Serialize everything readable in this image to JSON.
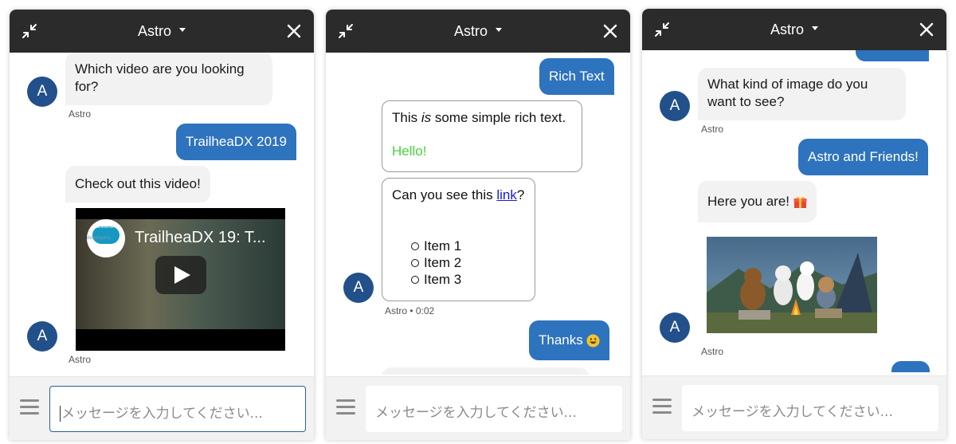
{
  "panels": [
    {
      "title": "Astro",
      "input_placeholder": "メッセージを入力してください...",
      "messages": {
        "q1": "Which video are you looking for?",
        "q1_sender": "Astro",
        "a1": "TrailheaDX 2019",
        "q2": "Check out this video!",
        "video_title": "TrailheaDX 19: T...",
        "video_logo": "salesforce",
        "video_logo_sub": "developers",
        "video_sender": "Astro"
      },
      "avatar_initial": "A"
    },
    {
      "title": "Astro",
      "input_placeholder": "メッセージを入力してください...",
      "messages": {
        "rich_text_label": "Rich Text",
        "rich_pre": "This ",
        "rich_em": "is",
        "rich_post": " some simple rich text.",
        "rich_hello": "Hello!",
        "link_pre": "Can you see this ",
        "link_text": "link",
        "link_post": "?",
        "items": [
          "Item 1",
          "Item 2",
          "Item 3"
        ],
        "meta": "Astro • 0:02",
        "thanks": "Thanks"
      },
      "avatar_initial": "A"
    },
    {
      "title": "Astro",
      "input_placeholder": "メッセージを入力してください...",
      "messages": {
        "q1": "What kind of image do you want to see?",
        "q1_sender": "Astro",
        "a1": "Astro and Friends!",
        "q2": "Here you are!",
        "image_sender": "Astro"
      },
      "avatar_initial": "A"
    }
  ],
  "icons": {
    "minimize": "minimize-icon",
    "close": "close-icon",
    "menu": "menu-icon",
    "smile": "smile-emoji-icon",
    "gift": "gift-emoji-icon"
  },
  "colors": {
    "header": "#2b2b2b",
    "outgoing": "#2e73bd",
    "avatar": "#22508a",
    "incoming": "#f2f2f2",
    "hello": "#48d23c"
  }
}
